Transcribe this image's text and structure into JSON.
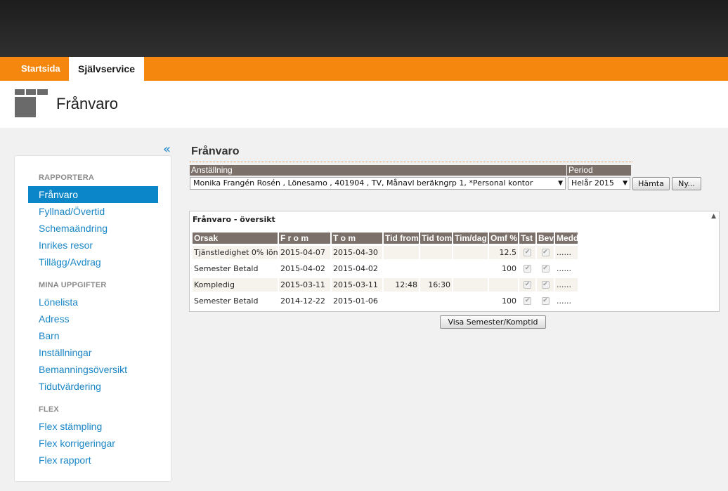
{
  "nav": {
    "start": "Startsida",
    "self": "Självservice"
  },
  "header": {
    "title": "Frånvaro",
    "logo_icon": "grid-logo-icon"
  },
  "sidebar": {
    "collapse": "«",
    "sections": [
      {
        "heading": "RAPPORTERA",
        "items": [
          "Frånvaro",
          "Fyllnad/Övertid",
          "Schemaändring",
          "Inrikes resor",
          "Tillägg/Avdrag"
        ]
      },
      {
        "heading": "MINA UPPGIFTER",
        "items": [
          "Lönelista",
          "Adress",
          "Barn",
          "Inställningar",
          "Bemanningsöversikt",
          "Tidutvärdering"
        ]
      },
      {
        "heading": "FLEX",
        "items": [
          "Flex stämpling",
          "Flex korrigeringar",
          "Flex rapport"
        ]
      }
    ],
    "active_item": "Frånvaro"
  },
  "main": {
    "title": "Frånvaro",
    "anstallning_label": "Anställning",
    "period_label": "Period",
    "anstallning_value": "Monika Frangén Rosén , Lönesamo , 401904 , TV, Månavl beräkngrp 1, *Personal kontor",
    "period_value": "Helår 2015",
    "hamta_button": "Hämta",
    "ny_button": "Ny...",
    "panel_title": "Frånvaro - översikt",
    "visa_button": "Visa Semester/Komptid"
  },
  "table": {
    "columns": [
      "Orsak",
      "F r o m",
      "T o m",
      "Tid from",
      "Tid tom",
      "Tim/dag",
      "Omf %",
      "Tst",
      "Bev",
      "Medd"
    ],
    "rows": [
      {
        "orsak": "Tjänstledighet 0% lön",
        "from": "2015-04-07",
        "tom": "2015-04-30",
        "tid_from": "",
        "tid_tom": "",
        "tim_dag": "",
        "omf": "12.5",
        "tst": true,
        "bev": true,
        "medd": "......"
      },
      {
        "orsak": "Semester Betald",
        "from": "2015-04-02",
        "tom": "2015-04-02",
        "tid_from": "",
        "tid_tom": "",
        "tim_dag": "",
        "omf": "100",
        "tst": true,
        "bev": true,
        "medd": "......"
      },
      {
        "orsak": "Kompledig",
        "from": "2015-03-11",
        "tom": "2015-03-11",
        "tid_from": "12:48",
        "tid_tom": "16:30",
        "tim_dag": "",
        "omf": "",
        "tst": true,
        "bev": true,
        "medd": "......"
      },
      {
        "orsak": "Semester Betald",
        "from": "2014-12-22",
        "tom": "2015-01-06",
        "tid_from": "",
        "tid_tom": "",
        "tim_dag": "",
        "omf": "100",
        "tst": true,
        "bev": true,
        "medd": "......"
      }
    ]
  },
  "colors": {
    "accent": "#f5870f",
    "link": "#1a86c6",
    "active": "#0b86c8",
    "table_header": "#7b716a"
  }
}
